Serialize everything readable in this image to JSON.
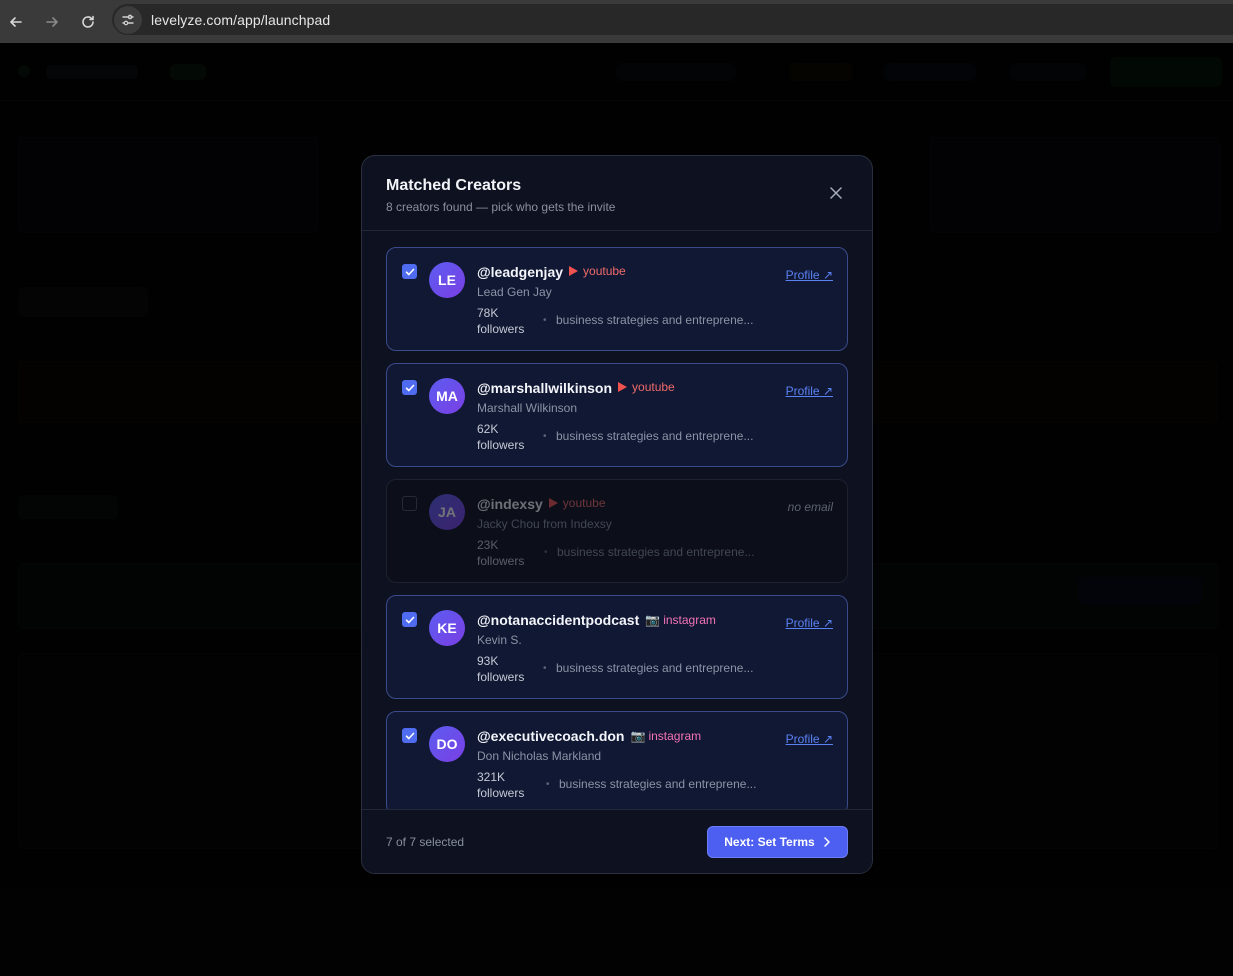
{
  "browser": {
    "url": "levelyze.com/app/launchpad",
    "back_icon": "arrow-left-icon",
    "forward_icon": "arrow-right-icon",
    "reload_icon": "reload-icon",
    "site_icon": "site-settings-icon"
  },
  "modal": {
    "title": "Matched Creators",
    "subtitle": "8 creators found — pick who gets the invite",
    "close_icon": "close-icon",
    "footer": {
      "selected_text": "7 of 7 selected",
      "next_label": "Next: Set Terms",
      "next_icon": "chevron-right-icon"
    }
  },
  "creators": [
    {
      "initials": "LE",
      "handle": "@leadgenjay",
      "platform": "youtube",
      "name": "Lead Gen Jay",
      "followers_count": "78K",
      "followers_word": "followers",
      "niche": "business strategies and entreprene...",
      "link": "Profile ↗",
      "selected": true
    },
    {
      "initials": "MA",
      "handle": "@marshallwilkinson",
      "platform": "youtube",
      "name": "Marshall Wilkinson",
      "followers_count": "62K",
      "followers_word": "followers",
      "niche": "business strategies and entreprene...",
      "link": "Profile ↗",
      "selected": true
    },
    {
      "initials": "JA",
      "handle": "@indexsy",
      "platform": "youtube",
      "name": "Jacky Chou from Indexsy",
      "followers_count": "23K",
      "followers_word": "followers",
      "niche": "business strategies and entreprene...",
      "link": "no email",
      "selected": false
    },
    {
      "initials": "KE",
      "handle": "@notanaccidentpodcast",
      "platform": "instagram",
      "name": "Kevin S.",
      "followers_count": "93K",
      "followers_word": "followers",
      "niche": "business strategies and entreprene...",
      "link": "Profile ↗",
      "selected": true
    },
    {
      "initials": "DO",
      "handle": "@executivecoach.don",
      "platform": "instagram",
      "name": "Don Nicholas Markland",
      "followers_count": "321K",
      "followers_word": "followers",
      "niche": "business strategies and entreprene...",
      "link": "Profile ↗",
      "selected": true
    }
  ],
  "colors": {
    "accent": "#4c5ff0",
    "youtube": "#f06b6b",
    "instagram": "#f472b6",
    "link": "#5b82f5"
  }
}
